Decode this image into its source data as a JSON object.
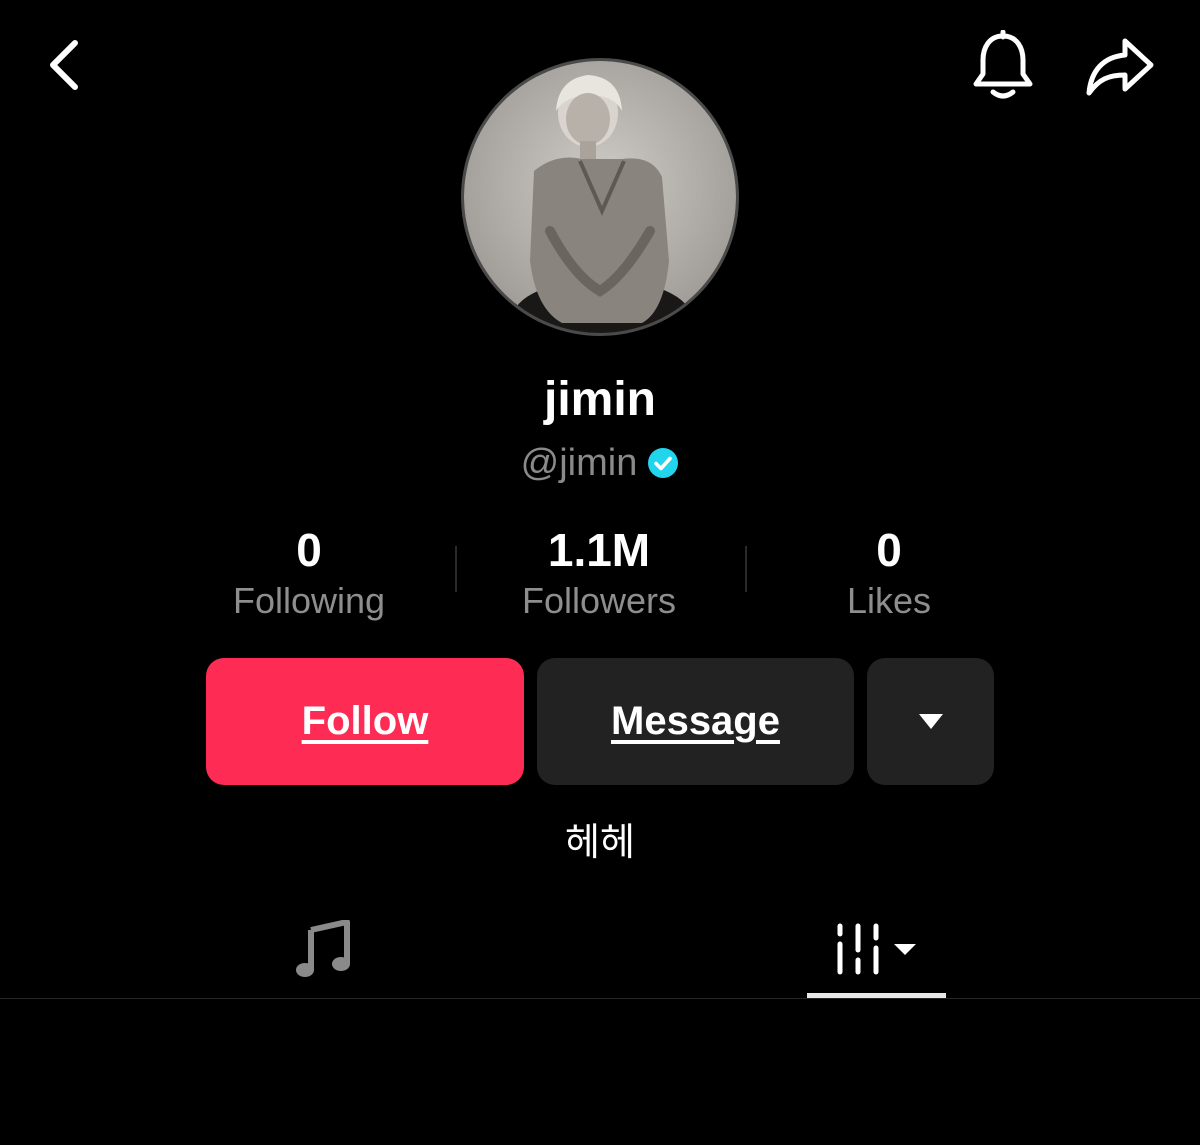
{
  "header": {
    "back_icon": "chevron-left-icon",
    "bell_icon": "bell-icon",
    "share_icon": "share-arrow-icon"
  },
  "profile": {
    "display_name": "jimin",
    "handle": "@jimin",
    "verified": true,
    "verified_color": "#20d5ec",
    "bio": "헤헤"
  },
  "stats": {
    "following": {
      "value": "0",
      "label": "Following"
    },
    "followers": {
      "value": "1.1M",
      "label": "Followers"
    },
    "likes": {
      "value": "0",
      "label": "Likes"
    }
  },
  "actions": {
    "follow_label": "Follow",
    "message_label": "Message",
    "follow_color": "#fe2c55",
    "more_icon": "caret-down-icon"
  },
  "tabs": [
    {
      "icon": "music-note-icon",
      "active": false
    },
    {
      "icon": "grid-filter-icon",
      "active": true
    }
  ]
}
